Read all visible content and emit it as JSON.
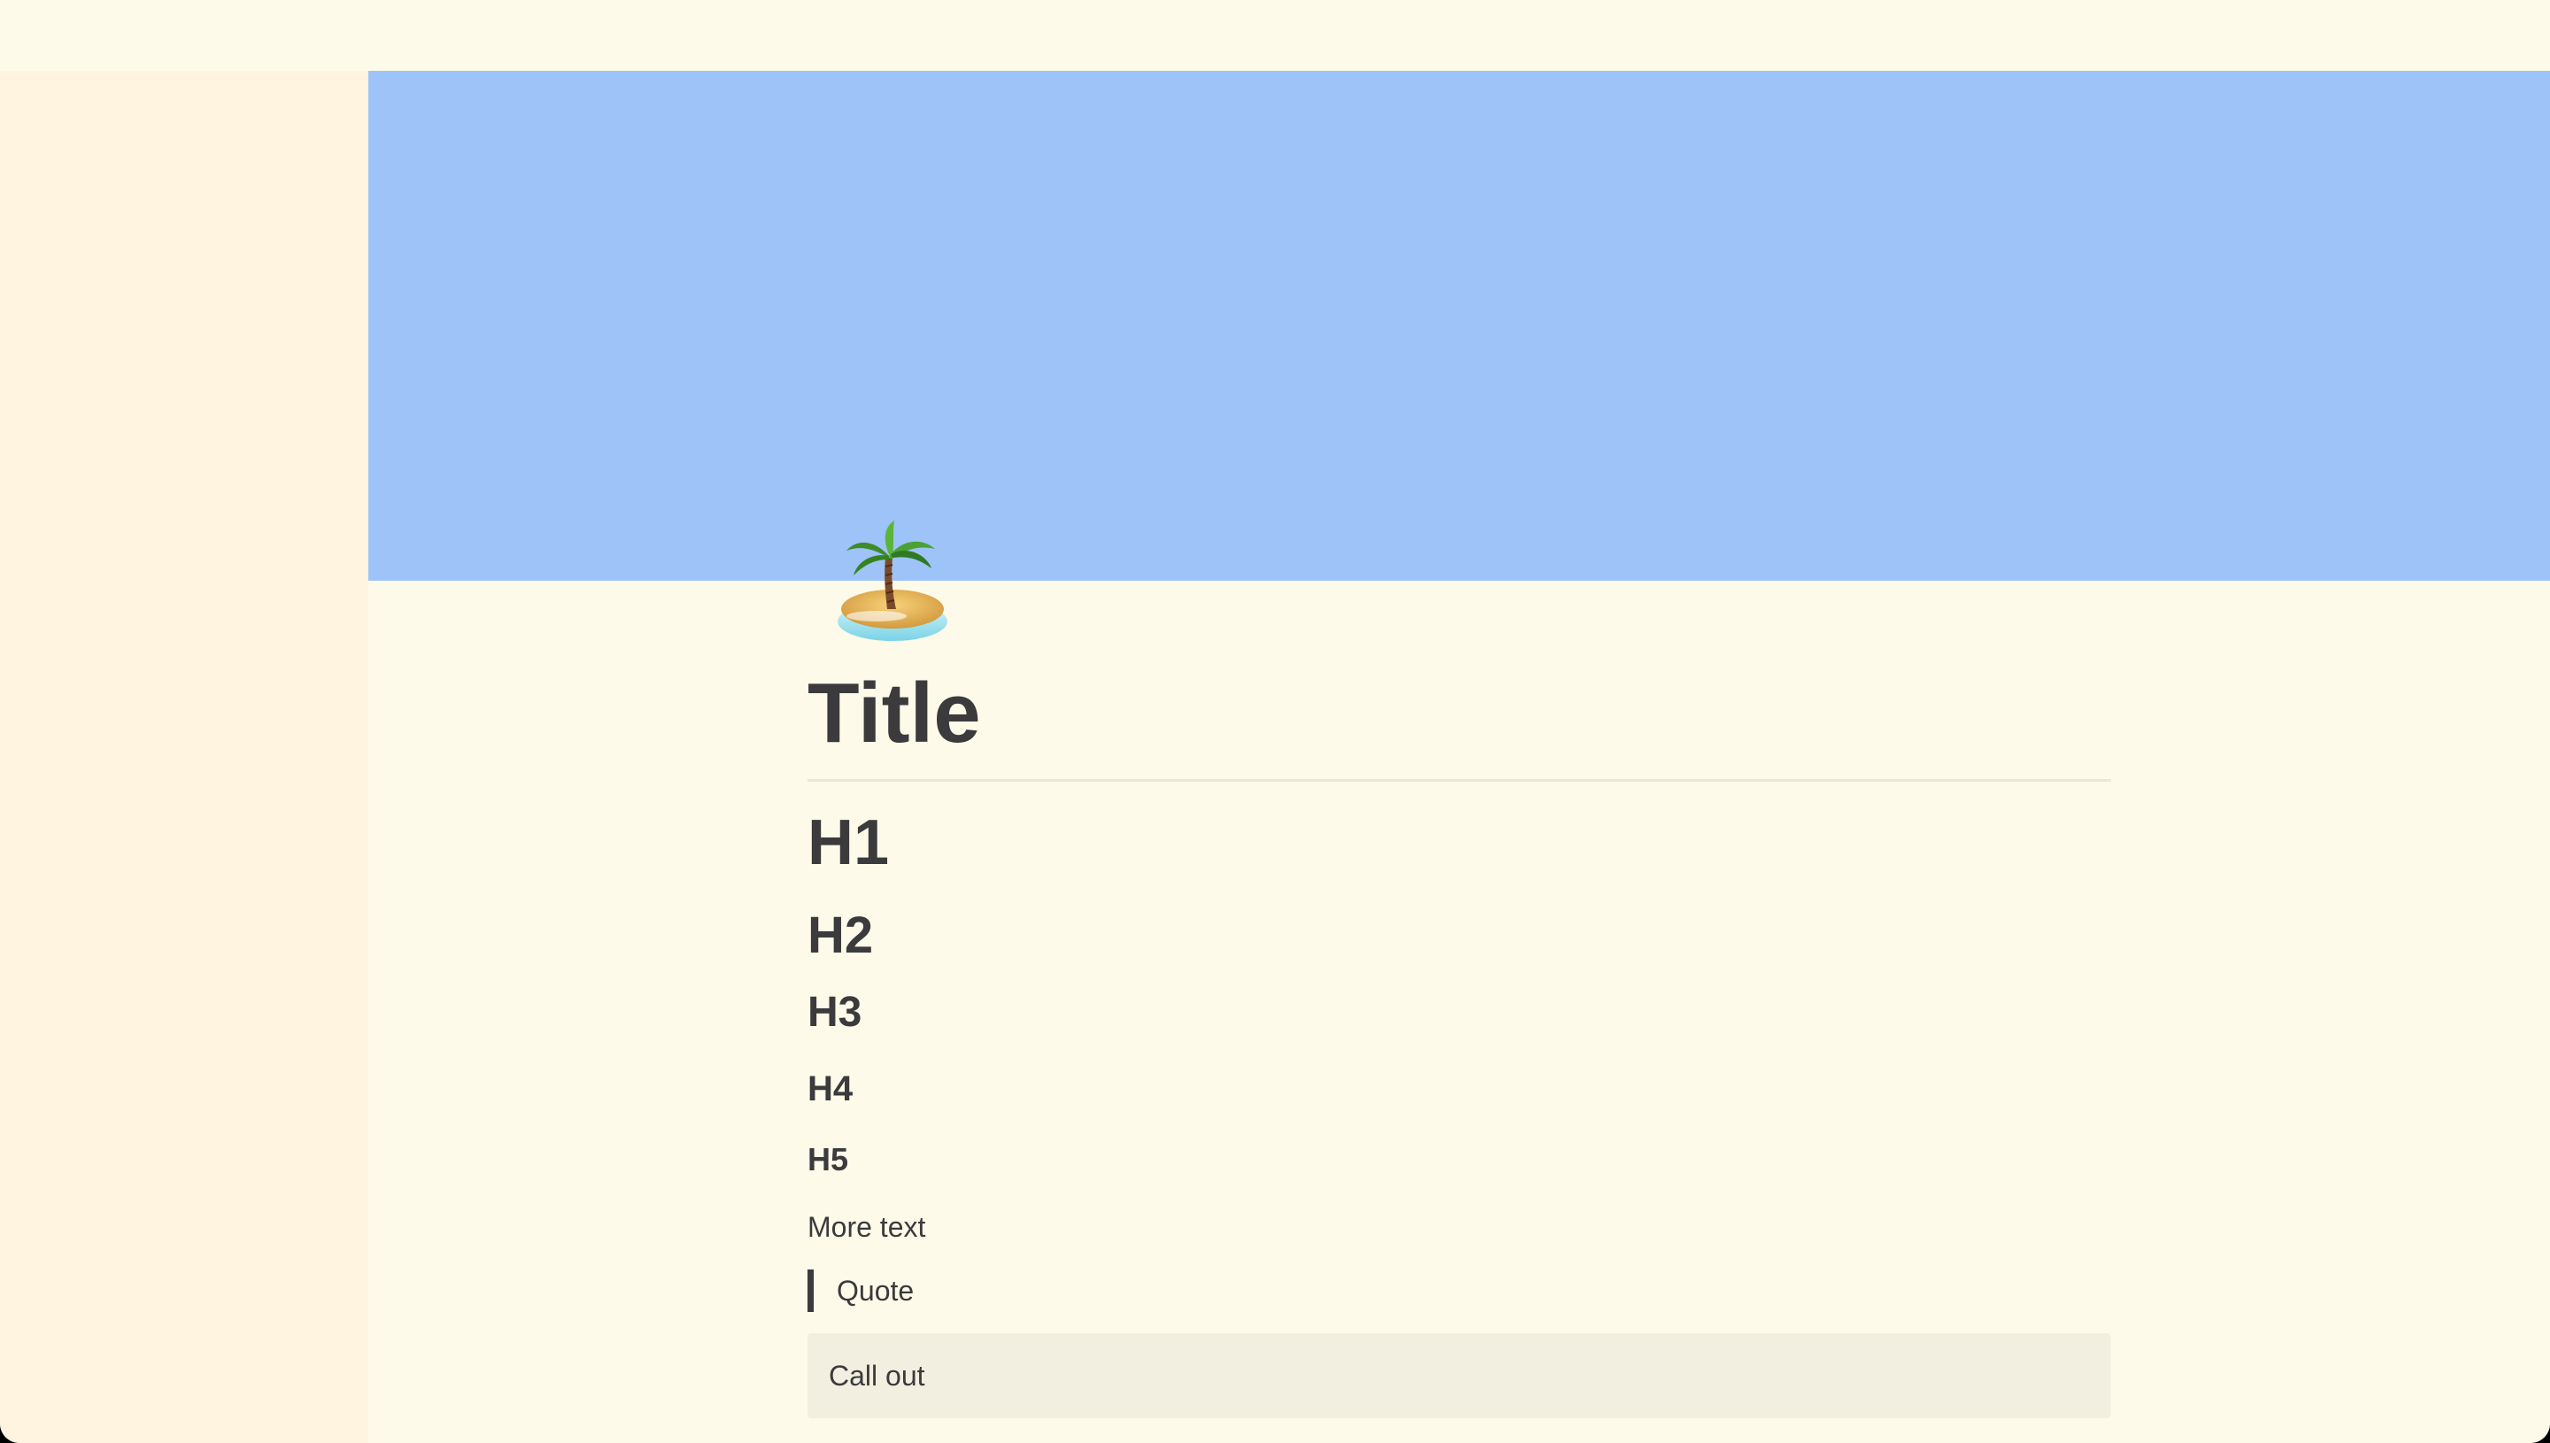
{
  "page": {
    "icon": "palm-island-icon",
    "title": "Title"
  },
  "blocks": {
    "h1": "H1",
    "h2": "H2",
    "h3": "H3",
    "h4": "H4",
    "h5": "H5",
    "text": "More text",
    "quote": "Quote",
    "callout": "Call out"
  },
  "colors": {
    "cover": "#9ec3f8",
    "background": "#fefae9",
    "sidebar": "#fef4df",
    "text": "#3b3a3c",
    "callout_bg": "#f2efe0"
  }
}
